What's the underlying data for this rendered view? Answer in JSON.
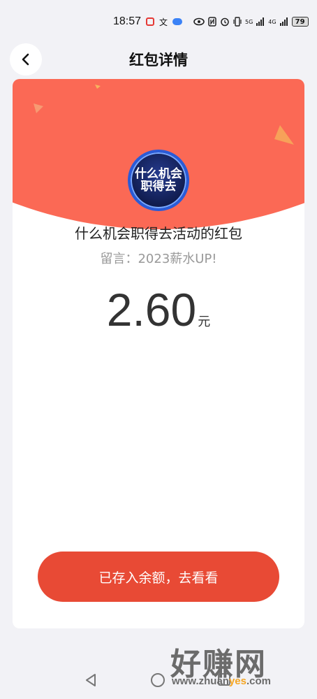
{
  "status_bar": {
    "time": "18:57",
    "text_icon": "文",
    "signal_left": "5G",
    "signal_right": "4G",
    "battery": "79"
  },
  "header": {
    "back_icon": "chevron-left-icon",
    "title": "红包详情"
  },
  "card": {
    "avatar_line1": "什么机会",
    "avatar_line2": "职得去",
    "red_packet_title": "什么机会职得去活动的红包",
    "message": "留言：2023薪水UP!",
    "amount": "2.60",
    "unit": "元",
    "cta_label": "已存入余额，去看看"
  },
  "colors": {
    "arc": "#fb6955",
    "button": "#e84a35",
    "background": "#f2f2f6"
  },
  "watermark": {
    "text": "好赚网",
    "url_prefix": "www.zhuan",
    "url_accent": "yes",
    "url_suffix": ".com"
  }
}
